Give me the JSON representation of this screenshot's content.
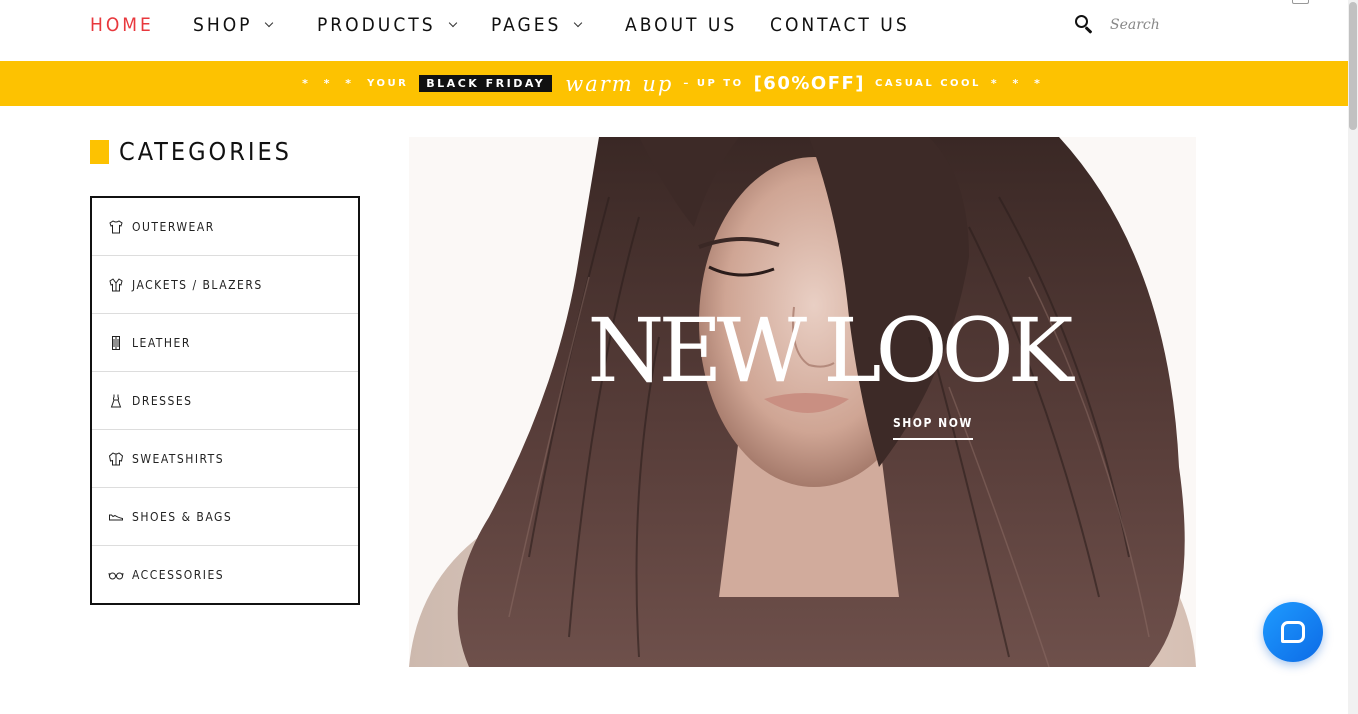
{
  "nav": {
    "items": [
      {
        "label": "HOME",
        "has_dropdown": false,
        "active": true
      },
      {
        "label": "SHOP",
        "has_dropdown": true,
        "active": false
      },
      {
        "label": "PRODUCTS",
        "has_dropdown": true,
        "active": false
      },
      {
        "label": "PAGES",
        "has_dropdown": true,
        "active": false
      },
      {
        "label": "ABOUT US",
        "has_dropdown": false,
        "active": false
      },
      {
        "label": "CONTACT US",
        "has_dropdown": false,
        "active": false
      }
    ],
    "search": {
      "placeholder": "Search"
    }
  },
  "promo": {
    "stars_left": "* * *",
    "your": "YOUR",
    "black_friday": "BLACK FRIDAY",
    "warm_up": "warm up",
    "dash_up_to": "– UP TO",
    "discount": "[60%OFF]",
    "casual_cool": "CASUAL COOL",
    "stars_right": "* * *"
  },
  "categories": {
    "title": "CATEGORIES",
    "items": [
      {
        "label": "OUTERWEAR",
        "icon": "tshirt-icon"
      },
      {
        "label": "JACKETS / BLAZERS",
        "icon": "jacket-icon"
      },
      {
        "label": "LEATHER",
        "icon": "leather-coat-icon"
      },
      {
        "label": "DRESSES",
        "icon": "dress-icon"
      },
      {
        "label": "SWEATSHIRTS",
        "icon": "sweatshirt-icon"
      },
      {
        "label": "SHOES & BAGS",
        "icon": "shoe-icon"
      },
      {
        "label": "ACCESSORIES",
        "icon": "glasses-icon"
      }
    ]
  },
  "hero": {
    "title": "NEW LOOK",
    "cta": "SHOP NOW"
  },
  "colors": {
    "accent": "#fdc201",
    "active_nav": "#e8383d",
    "chat": "#1e9bff"
  }
}
